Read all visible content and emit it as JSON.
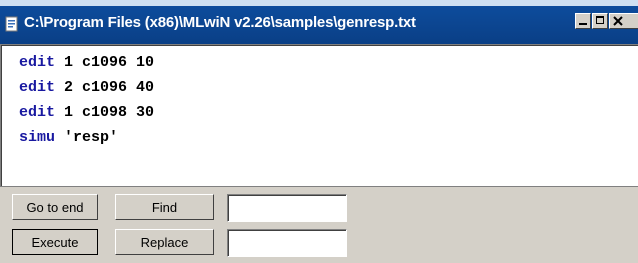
{
  "window": {
    "title": "C:\\Program Files (x86)\\MLwiN v2.26\\samples\\genresp.txt",
    "controls": {
      "minimize": "_",
      "maximize": "□",
      "close": "X"
    }
  },
  "editor": {
    "lines": [
      {
        "keyword": "edit",
        "args": " 1 c1096 10"
      },
      {
        "keyword": "edit",
        "args": " 2 c1096 40"
      },
      {
        "keyword": "edit",
        "args": " 1 c1098 30"
      },
      {
        "keyword": "simu",
        "args": " 'resp'"
      }
    ]
  },
  "toolbar": {
    "go_to_end_label": "Go to end",
    "find_label": "Find",
    "find_value": "",
    "execute_label": "Execute",
    "replace_label": "Replace",
    "replace_value": ""
  },
  "icons": {
    "app": "document-icon"
  },
  "colors": {
    "titlebar": "#0a3f86",
    "keyword": "#1818a0",
    "panel": "#d4d0c8"
  }
}
